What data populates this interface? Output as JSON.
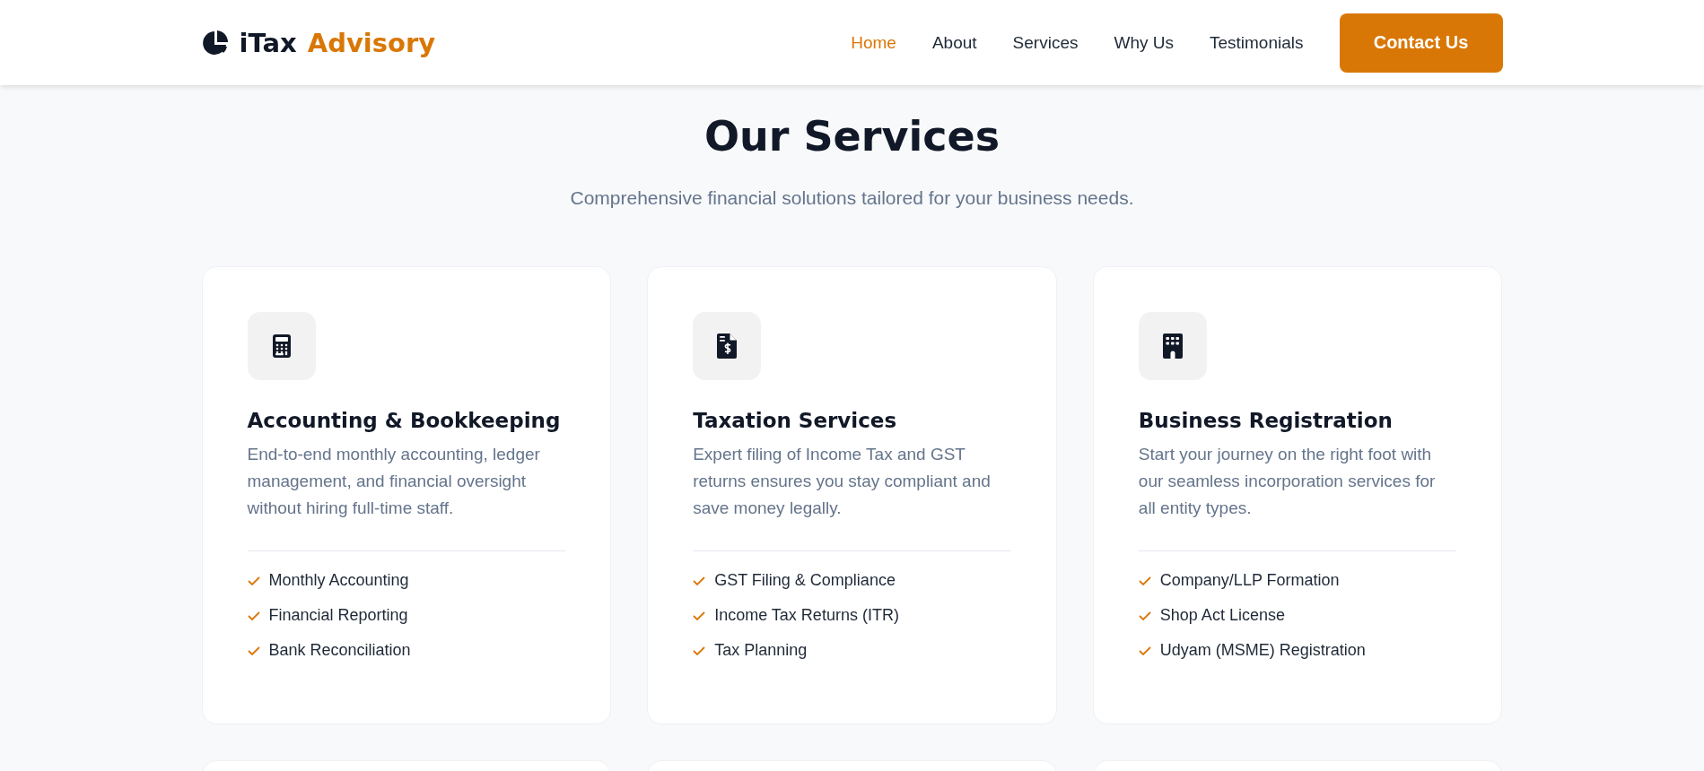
{
  "header": {
    "logo": {
      "name": "iTax",
      "accent": "Advisory"
    },
    "nav": [
      {
        "label": "Home",
        "selected": true
      },
      {
        "label": "About",
        "selected": false
      },
      {
        "label": "Services",
        "selected": false
      },
      {
        "label": "Why Us",
        "selected": false
      },
      {
        "label": "Testimonials",
        "selected": false
      }
    ],
    "cta": "Contact Us"
  },
  "section": {
    "title": "Our Services",
    "subtitle": "Comprehensive financial solutions tailored for your business needs."
  },
  "services": [
    {
      "kind": "calculator",
      "title": "Accounting & Bookkeeping",
      "description": "End-to-end monthly accounting, ledger management, and financial oversight without hiring full-time staff.",
      "features": [
        "Monthly Accounting",
        "Financial Reporting",
        "Bank Reconciliation"
      ]
    },
    {
      "kind": "tax-document",
      "title": "Taxation Services",
      "description": "Expert filing of Income Tax and GST returns ensures you stay compliant and save money legally.",
      "features": [
        "GST Filing & Compliance",
        "Income Tax Returns (ITR)",
        "Tax Planning"
      ]
    },
    {
      "kind": "building",
      "title": "Business Registration",
      "description": "Start your journey on the right foot with our seamless incorporation services for all entity types.",
      "features": [
        "Company/LLP Formation",
        "Shop Act License",
        "Udyam (MSME) Registration"
      ]
    }
  ]
}
